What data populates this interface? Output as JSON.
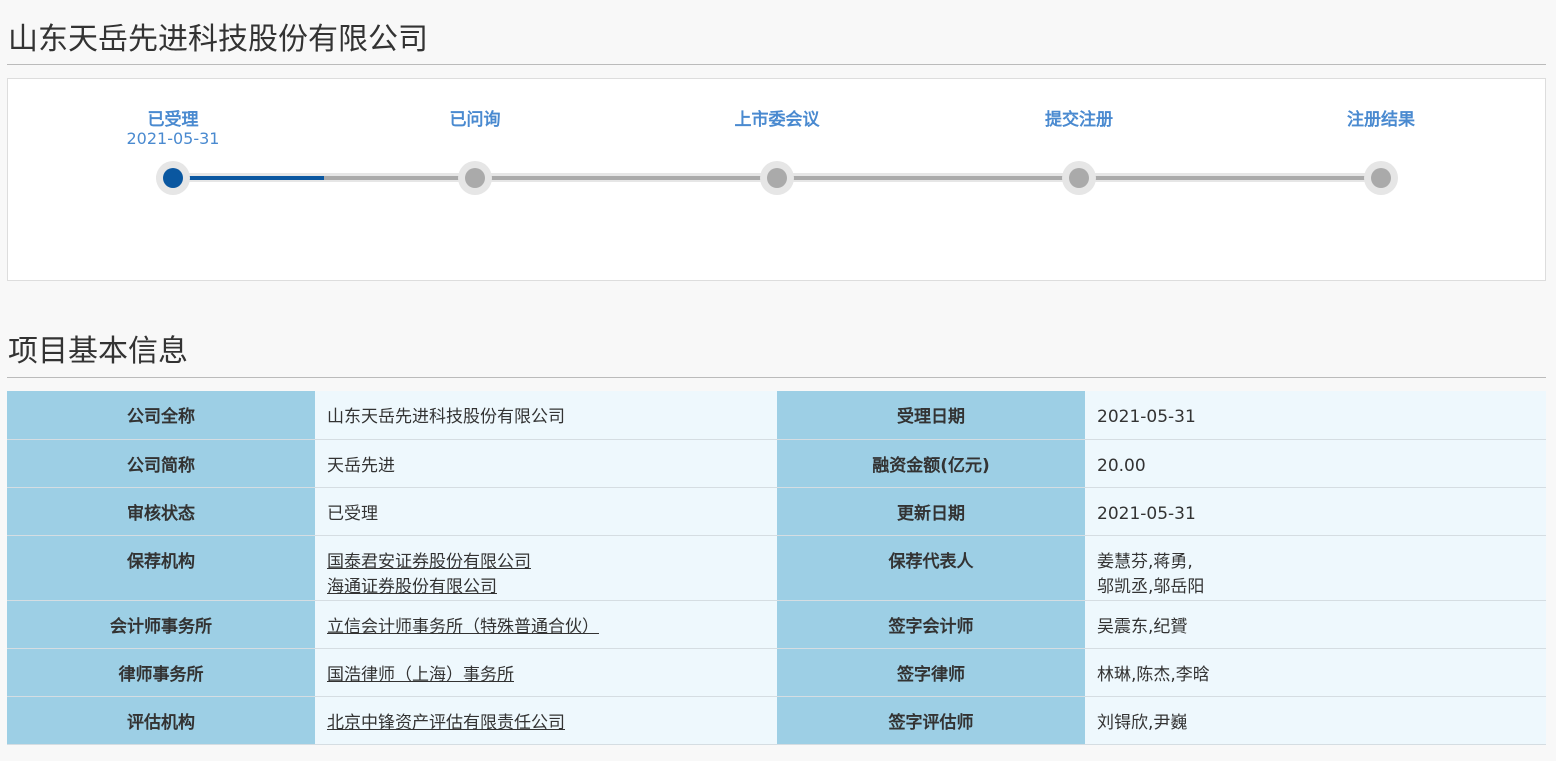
{
  "title": "山东天岳先进科技股份有限公司",
  "progress": {
    "steps": [
      {
        "label": "已受理",
        "date": "2021-05-31",
        "active": true
      },
      {
        "label": "已问询",
        "date": ""
      },
      {
        "label": "上市委会议",
        "date": ""
      },
      {
        "label": "提交注册",
        "date": ""
      },
      {
        "label": "注册结果",
        "date": ""
      }
    ],
    "active_color": "#0a57a0"
  },
  "section_title": "项目基本信息",
  "table": [
    {
      "k1": "公司全称",
      "v1": [
        "山东天岳先进科技股份有限公司"
      ],
      "k2": "受理日期",
      "v2": [
        "2021-05-31"
      ]
    },
    {
      "k1": "公司简称",
      "v1": [
        "天岳先进"
      ],
      "k2": "融资金额(亿元)",
      "v2": [
        "20.00"
      ]
    },
    {
      "k1": "审核状态",
      "v1": [
        "已受理"
      ],
      "k2": "更新日期",
      "v2": [
        "2021-05-31"
      ]
    },
    {
      "k1": "保荐机构",
      "v1": [
        "国泰君安证券股份有限公司",
        "海通证券股份有限公司"
      ],
      "links": true,
      "k2": "保荐代表人",
      "v2": [
        "姜慧芬,蒋勇,",
        "邬凯丞,邬岳阳"
      ]
    },
    {
      "k1": "会计师事务所",
      "v1": [
        "立信会计师事务所（特殊普通合伙）"
      ],
      "links": true,
      "k2": "签字会计师",
      "v2": [
        "吴震东,纪贇"
      ]
    },
    {
      "k1": "律师事务所",
      "v1": [
        "国浩律师（上海）事务所"
      ],
      "links": true,
      "k2": "签字律师",
      "v2": [
        "林琳,陈杰,李晗"
      ]
    },
    {
      "k1": "评估机构",
      "v1": [
        "北京中锋资产评估有限责任公司"
      ],
      "links": true,
      "k2": "签字评估师",
      "v2": [
        "刘锝欣,尹巍"
      ]
    }
  ]
}
